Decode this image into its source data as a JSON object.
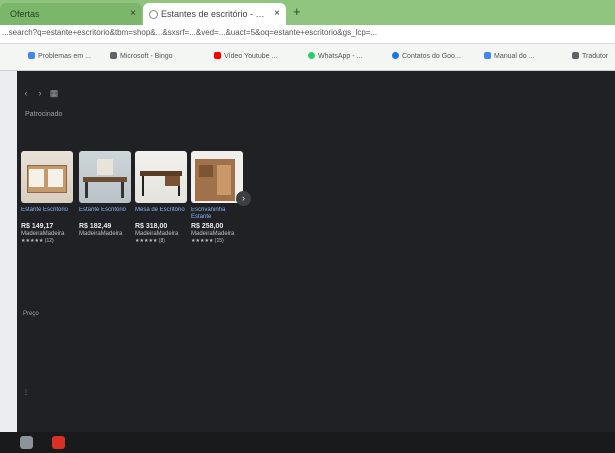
{
  "browser": {
    "tabs": [
      {
        "label": "Ofertas"
      },
      {
        "label": "Estantes de escritório - Google"
      }
    ],
    "url": "...search?q=estante+escritorio&tbm=shop&...&sxsrf=...&ved=...&uact=5&oq=estante+escritorio&gs_lcp=...",
    "bookmarks": [
      {
        "label": "Problemas em ...",
        "icon_color": "#4285f4"
      },
      {
        "label": "Microsoft - Bingo",
        "icon_color": "#5f6368"
      },
      {
        "label": "Vídeo Youtube ...",
        "icon_color": "#ff0000"
      },
      {
        "label": "WhatsApp - ...",
        "icon_color": "#25d366"
      },
      {
        "label": "Contatos do Goo...",
        "icon_color": "#1a73e8"
      },
      {
        "label": "Manual do ...",
        "icon_color": "#4285f4"
      },
      {
        "label": "Tradutor",
        "icon_color": "#5f6368"
      }
    ]
  },
  "content": {
    "section_label": "Patrocinado",
    "products": [
      {
        "title": "Estante Escritório",
        "price": "R$ 149,17",
        "store": "MadeiraMadeira",
        "rating": "★★★★★ (12)"
      },
      {
        "title": "Estante Escritório",
        "price": "R$ 182,49",
        "store": "MadeiraMadeira",
        "rating": ""
      },
      {
        "title": "Mesa de Escritório",
        "price": "R$ 318,00",
        "store": "MadeiraMadeira",
        "rating": "★★★★★ (8)"
      },
      {
        "title": "Escrivaninha Estante",
        "price": "R$ 258,00",
        "store": "MadeiraMadeira",
        "rating": "★★★★★ (15)"
      }
    ],
    "next_label": "›",
    "side_note": "Preço",
    "side_note2": "⋮"
  }
}
